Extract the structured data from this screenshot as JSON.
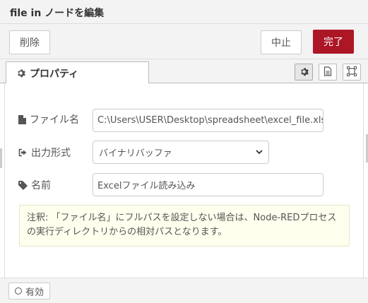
{
  "window": {
    "title": "file in ノードを編集"
  },
  "toolbar": {
    "delete_label": "削除",
    "cancel_label": "中止",
    "done_label": "完了",
    "done_color": "#ad1625"
  },
  "tabs": {
    "properties_label": "プロパティ",
    "properties_icon": "gear-icon",
    "side_buttons": [
      "gear-icon",
      "document-icon",
      "frame-icon"
    ]
  },
  "form": {
    "filename": {
      "label": "ファイル名",
      "icon": "file-icon",
      "value": "C:\\Users\\USER\\Desktop\\spreadsheet\\excel_file.xlsx"
    },
    "format": {
      "label": "出力形式",
      "icon": "sign-out-icon",
      "selected": "バイナリバッファ"
    },
    "name": {
      "label": "名前",
      "icon": "tag-icon",
      "value": "Excelファイル読み込み"
    }
  },
  "tip": {
    "text": "注釈: 「ファイル名」にフルパスを設定しない場合は、Node-REDプロセスの実行ディレクトリからの相対パスとなります。"
  },
  "footer": {
    "enabled_label": "有効"
  }
}
